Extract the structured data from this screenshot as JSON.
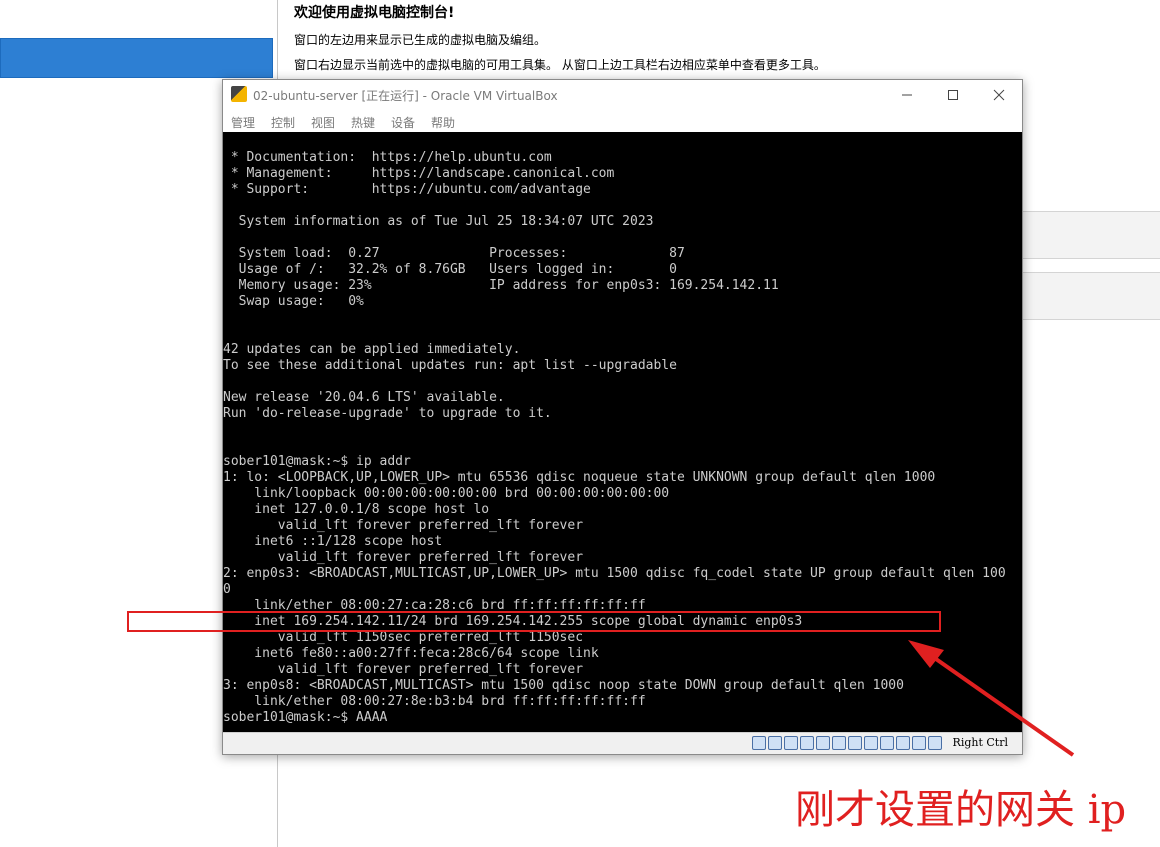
{
  "manager": {
    "welcome_title": "欢迎使用虚拟电脑控制台!",
    "welcome_line1": "窗口的左边用来显示已生成的虚拟电脑及编组。",
    "welcome_line2": "窗口右边显示当前选中的虚拟电脑的可用工具集。 从窗口上边工具栏右边相应菜单中查看更多工具。"
  },
  "vm_window": {
    "title": "02-ubuntu-server [正在运行] - Oracle VM VirtualBox",
    "menu": [
      "管理",
      "控制",
      "视图",
      "热键",
      "设备",
      "帮助"
    ],
    "host_key": "Right Ctrl"
  },
  "console_lines": [
    "",
    " * Documentation:  https://help.ubuntu.com",
    " * Management:     https://landscape.canonical.com",
    " * Support:        https://ubuntu.com/advantage",
    "",
    "  System information as of Tue Jul 25 18:34:07 UTC 2023",
    "",
    "  System load:  0.27              Processes:             87",
    "  Usage of /:   32.2% of 8.76GB   Users logged in:       0",
    "  Memory usage: 23%               IP address for enp0s3: 169.254.142.11",
    "  Swap usage:   0%",
    "",
    "",
    "42 updates can be applied immediately.",
    "To see these additional updates run: apt list --upgradable",
    "",
    "New release '20.04.6 LTS' available.",
    "Run 'do-release-upgrade' to upgrade to it.",
    "",
    "",
    "sober101@mask:~$ ip addr",
    "1: lo: <LOOPBACK,UP,LOWER_UP> mtu 65536 qdisc noqueue state UNKNOWN group default qlen 1000",
    "    link/loopback 00:00:00:00:00:00 brd 00:00:00:00:00:00",
    "    inet 127.0.0.1/8 scope host lo",
    "       valid_lft forever preferred_lft forever",
    "    inet6 ::1/128 scope host",
    "       valid_lft forever preferred_lft forever",
    "2: enp0s3: <BROADCAST,MULTICAST,UP,LOWER_UP> mtu 1500 qdisc fq_codel state UP group default qlen 100",
    "0",
    "    link/ether 08:00:27:ca:28:c6 brd ff:ff:ff:ff:ff:ff",
    "    inet 169.254.142.11/24 brd 169.254.142.255 scope global dynamic enp0s3",
    "       valid_lft 1150sec preferred_lft 1150sec",
    "    inet6 fe80::a00:27ff:feca:28c6/64 scope link",
    "       valid_lft forever preferred_lft forever",
    "3: enp0s8: <BROADCAST,MULTICAST> mtu 1500 qdisc noop state DOWN group default qlen 1000",
    "    link/ether 08:00:27:8e:b3:b4 brd ff:ff:ff:ff:ff:ff",
    "sober101@mask:~$ AAAA"
  ],
  "annotation": {
    "text": "刚才设置的网关 ip",
    "color": "#e02020"
  }
}
